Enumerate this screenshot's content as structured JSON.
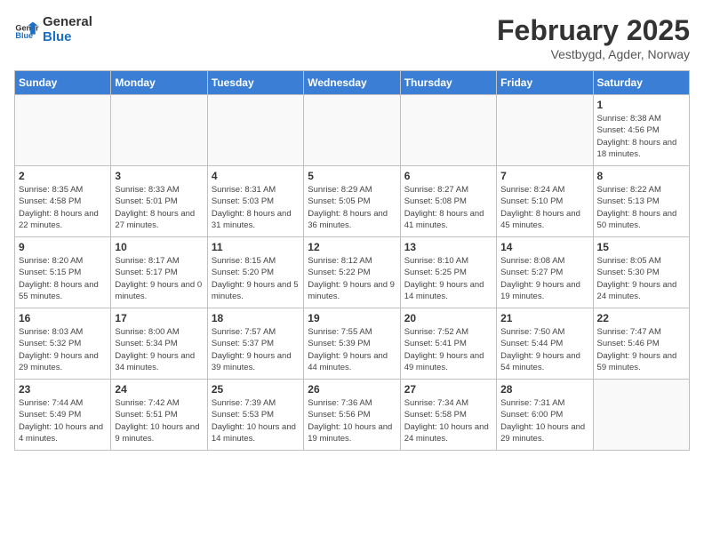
{
  "header": {
    "logo_line1": "General",
    "logo_line2": "Blue",
    "month": "February 2025",
    "location": "Vestbygd, Agder, Norway"
  },
  "days_of_week": [
    "Sunday",
    "Monday",
    "Tuesday",
    "Wednesday",
    "Thursday",
    "Friday",
    "Saturday"
  ],
  "weeks": [
    [
      {
        "num": "",
        "info": ""
      },
      {
        "num": "",
        "info": ""
      },
      {
        "num": "",
        "info": ""
      },
      {
        "num": "",
        "info": ""
      },
      {
        "num": "",
        "info": ""
      },
      {
        "num": "",
        "info": ""
      },
      {
        "num": "1",
        "info": "Sunrise: 8:38 AM\nSunset: 4:56 PM\nDaylight: 8 hours and 18 minutes."
      }
    ],
    [
      {
        "num": "2",
        "info": "Sunrise: 8:35 AM\nSunset: 4:58 PM\nDaylight: 8 hours and 22 minutes."
      },
      {
        "num": "3",
        "info": "Sunrise: 8:33 AM\nSunset: 5:01 PM\nDaylight: 8 hours and 27 minutes."
      },
      {
        "num": "4",
        "info": "Sunrise: 8:31 AM\nSunset: 5:03 PM\nDaylight: 8 hours and 31 minutes."
      },
      {
        "num": "5",
        "info": "Sunrise: 8:29 AM\nSunset: 5:05 PM\nDaylight: 8 hours and 36 minutes."
      },
      {
        "num": "6",
        "info": "Sunrise: 8:27 AM\nSunset: 5:08 PM\nDaylight: 8 hours and 41 minutes."
      },
      {
        "num": "7",
        "info": "Sunrise: 8:24 AM\nSunset: 5:10 PM\nDaylight: 8 hours and 45 minutes."
      },
      {
        "num": "8",
        "info": "Sunrise: 8:22 AM\nSunset: 5:13 PM\nDaylight: 8 hours and 50 minutes."
      }
    ],
    [
      {
        "num": "9",
        "info": "Sunrise: 8:20 AM\nSunset: 5:15 PM\nDaylight: 8 hours and 55 minutes."
      },
      {
        "num": "10",
        "info": "Sunrise: 8:17 AM\nSunset: 5:17 PM\nDaylight: 9 hours and 0 minutes."
      },
      {
        "num": "11",
        "info": "Sunrise: 8:15 AM\nSunset: 5:20 PM\nDaylight: 9 hours and 5 minutes."
      },
      {
        "num": "12",
        "info": "Sunrise: 8:12 AM\nSunset: 5:22 PM\nDaylight: 9 hours and 9 minutes."
      },
      {
        "num": "13",
        "info": "Sunrise: 8:10 AM\nSunset: 5:25 PM\nDaylight: 9 hours and 14 minutes."
      },
      {
        "num": "14",
        "info": "Sunrise: 8:08 AM\nSunset: 5:27 PM\nDaylight: 9 hours and 19 minutes."
      },
      {
        "num": "15",
        "info": "Sunrise: 8:05 AM\nSunset: 5:30 PM\nDaylight: 9 hours and 24 minutes."
      }
    ],
    [
      {
        "num": "16",
        "info": "Sunrise: 8:03 AM\nSunset: 5:32 PM\nDaylight: 9 hours and 29 minutes."
      },
      {
        "num": "17",
        "info": "Sunrise: 8:00 AM\nSunset: 5:34 PM\nDaylight: 9 hours and 34 minutes."
      },
      {
        "num": "18",
        "info": "Sunrise: 7:57 AM\nSunset: 5:37 PM\nDaylight: 9 hours and 39 minutes."
      },
      {
        "num": "19",
        "info": "Sunrise: 7:55 AM\nSunset: 5:39 PM\nDaylight: 9 hours and 44 minutes."
      },
      {
        "num": "20",
        "info": "Sunrise: 7:52 AM\nSunset: 5:41 PM\nDaylight: 9 hours and 49 minutes."
      },
      {
        "num": "21",
        "info": "Sunrise: 7:50 AM\nSunset: 5:44 PM\nDaylight: 9 hours and 54 minutes."
      },
      {
        "num": "22",
        "info": "Sunrise: 7:47 AM\nSunset: 5:46 PM\nDaylight: 9 hours and 59 minutes."
      }
    ],
    [
      {
        "num": "23",
        "info": "Sunrise: 7:44 AM\nSunset: 5:49 PM\nDaylight: 10 hours and 4 minutes."
      },
      {
        "num": "24",
        "info": "Sunrise: 7:42 AM\nSunset: 5:51 PM\nDaylight: 10 hours and 9 minutes."
      },
      {
        "num": "25",
        "info": "Sunrise: 7:39 AM\nSunset: 5:53 PM\nDaylight: 10 hours and 14 minutes."
      },
      {
        "num": "26",
        "info": "Sunrise: 7:36 AM\nSunset: 5:56 PM\nDaylight: 10 hours and 19 minutes."
      },
      {
        "num": "27",
        "info": "Sunrise: 7:34 AM\nSunset: 5:58 PM\nDaylight: 10 hours and 24 minutes."
      },
      {
        "num": "28",
        "info": "Sunrise: 7:31 AM\nSunset: 6:00 PM\nDaylight: 10 hours and 29 minutes."
      },
      {
        "num": "",
        "info": ""
      }
    ]
  ]
}
